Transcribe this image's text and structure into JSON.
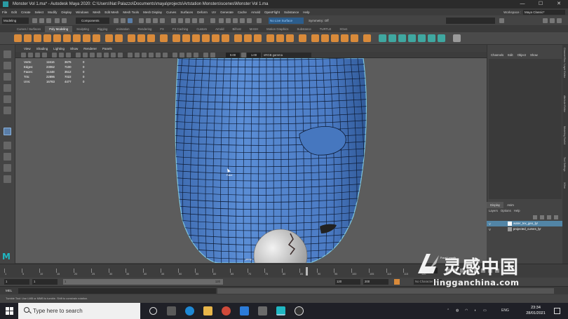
{
  "titlebar": {
    "title": "Monster Vol 1.ma* - Autodesk Maya 2020: C:\\Users\\Nat Palazzo\\Documents\\maya\\projects\\Artstation Monsters\\scenes\\Monster Vol 1.ma",
    "buttons": [
      "minimize-icon",
      "maximize-icon",
      "close-icon"
    ]
  },
  "menubar": {
    "items": [
      "File",
      "Edit",
      "Create",
      "Select",
      "Modify",
      "Display",
      "Windows",
      "Mesh",
      "Edit Mesh",
      "Mesh Tools",
      "Mesh Display",
      "Curves",
      "Surfaces",
      "Deform",
      "UV",
      "Generate",
      "Cache",
      "Arnold",
      "OpenFlight",
      "Substance",
      "Help"
    ],
    "workspace_label": "Workspace :",
    "workspace_value": "Maya Classic*"
  },
  "statusline": {
    "menuset": "Modeling",
    "selection_mode": "Components",
    "live_surface": "No Live Surface",
    "symmetry": "Symmetry: Off"
  },
  "shelf": {
    "tabs": [
      "Curves / Surfaces",
      "Poly Modeling",
      "Sculpting",
      "Rigging",
      "Animation",
      "Rendering",
      "FX",
      "FX Caching",
      "Custom",
      "Arnold",
      "Bifrost",
      "MASH",
      "Motion Graphics",
      "Substance",
      "TURTLE",
      "XGen"
    ],
    "active_tab": "Poly Modeling"
  },
  "panel": {
    "menus": [
      "View",
      "Shading",
      "Lighting",
      "Show",
      "Renderer",
      "Panels"
    ],
    "near_value": "0.00",
    "far_value": "1.00",
    "color_space": "sRGB gamma"
  },
  "hud": {
    "rows": [
      {
        "label": "Verts:",
        "a": "11616",
        "b": "3676",
        "c": "0"
      },
      {
        "label": "Edges:",
        "a": "23062",
        "b": "7100",
        "c": "0"
      },
      {
        "label": "Faces:",
        "a": "11448",
        "b": "3512",
        "c": "0"
      },
      {
        "label": "Tris:",
        "a": "22896",
        "b": "7022",
        "c": "0"
      },
      {
        "label": "UVs:",
        "a": "16783",
        "b": "4477",
        "c": "0"
      }
    ],
    "cursor_label": "Face",
    "camera_label": "persp",
    "focal_label": "Focal Length"
  },
  "channelbox": {
    "menus": [
      "Channels",
      "Edit",
      "Object",
      "Show"
    ]
  },
  "layers": {
    "tabs": [
      "Display",
      "Anim"
    ],
    "active_tab": "Display",
    "menus": [
      "Layers",
      "Options",
      "Help"
    ],
    "items": [
      {
        "vis": "V",
        "name": "water_tex_geo_lyr",
        "selected": true
      },
      {
        "vis": "V",
        "name": "projected_curves_lyr",
        "selected": false
      }
    ]
  },
  "vtabs": [
    "Channel Box / Layer Editor",
    "Attribute Editor",
    "Modeling Toolkit",
    "Tool Settings",
    "XGen"
  ],
  "timeslider": {
    "labels": [
      "1",
      "5",
      "10",
      "15",
      "20",
      "25",
      "30",
      "35",
      "40",
      "45",
      "50",
      "55",
      "60",
      "65",
      "70",
      "75",
      "80",
      "85",
      "90",
      "95",
      "100",
      "105",
      "110",
      "115",
      "120"
    ],
    "current_frame": "1"
  },
  "rangeslider": {
    "start": "1",
    "anim_start": "1",
    "range_lo": "1",
    "range_hi": "120",
    "end": "120",
    "anim_end": "200",
    "character_set": "No Character Set"
  },
  "cmdline": {
    "label": "MEL"
  },
  "helpline": {
    "text": "Tumble Tool: Use LMB or MMB to tumble. Shift to constrain rotation."
  },
  "taskbar": {
    "search_placeholder": "Type here to search",
    "apps": [
      "task-view-icon",
      "widgets-icon",
      "edge-icon",
      "file-explorer-icon",
      "chrome-icon",
      "mail-icon",
      "calculator-icon",
      "maya-icon",
      "obs-icon"
    ],
    "lang": "ENG",
    "time": "23:34",
    "date": "28/01/2021"
  },
  "logo": {
    "maya_letter": "M"
  },
  "watermark": {
    "cn": "灵感中国",
    "url": "lingganchina.com"
  }
}
